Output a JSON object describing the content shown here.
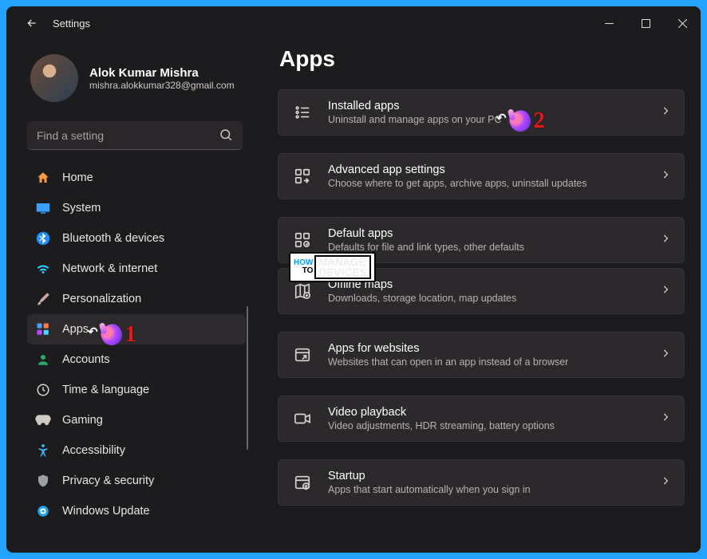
{
  "window": {
    "title": "Settings"
  },
  "profile": {
    "name": "Alok Kumar Mishra",
    "email": "mishra.alokkumar328@gmail.com"
  },
  "search": {
    "placeholder": "Find a setting"
  },
  "nav": [
    {
      "id": "home",
      "label": "Home",
      "icon": "home-icon"
    },
    {
      "id": "system",
      "label": "System",
      "icon": "display-icon"
    },
    {
      "id": "bluetooth",
      "label": "Bluetooth & devices",
      "icon": "bluetooth-icon"
    },
    {
      "id": "network",
      "label": "Network & internet",
      "icon": "wifi-icon"
    },
    {
      "id": "personalization",
      "label": "Personalization",
      "icon": "paintbrush-icon"
    },
    {
      "id": "apps",
      "label": "Apps",
      "icon": "apps-grid-icon",
      "selected": true
    },
    {
      "id": "accounts",
      "label": "Accounts",
      "icon": "person-icon"
    },
    {
      "id": "time",
      "label": "Time & language",
      "icon": "clock-globe-icon"
    },
    {
      "id": "gaming",
      "label": "Gaming",
      "icon": "gamepad-icon"
    },
    {
      "id": "accessibility",
      "label": "Accessibility",
      "icon": "accessibility-icon"
    },
    {
      "id": "privacy",
      "label": "Privacy & security",
      "icon": "shield-icon"
    },
    {
      "id": "update",
      "label": "Windows Update",
      "icon": "update-icon"
    }
  ],
  "page": {
    "title": "Apps"
  },
  "tiles": [
    {
      "id": "installed",
      "title": "Installed apps",
      "sub": "Uninstall and manage apps on your PC"
    },
    {
      "id": "advanced",
      "title": "Advanced app settings",
      "sub": "Choose where to get apps, archive apps, uninstall updates"
    },
    {
      "id": "defaults",
      "title": "Default apps",
      "sub": "Defaults for file and link types, other defaults"
    },
    {
      "id": "offline",
      "title": "Offline maps",
      "sub": "Downloads, storage location, map updates"
    },
    {
      "id": "websites",
      "title": "Apps for websites",
      "sub": "Websites that can open in an app instead of a browser"
    },
    {
      "id": "video",
      "title": "Video playback",
      "sub": "Video adjustments, HDR streaming, battery options"
    },
    {
      "id": "startup",
      "title": "Startup",
      "sub": "Apps that start automatically when you sign in"
    }
  ],
  "annotations": {
    "step1": "1",
    "step2": "2",
    "watermark": {
      "how": "HOW",
      "to": "TO",
      "line1": "MANAGE",
      "line2": "DEVICES"
    }
  }
}
